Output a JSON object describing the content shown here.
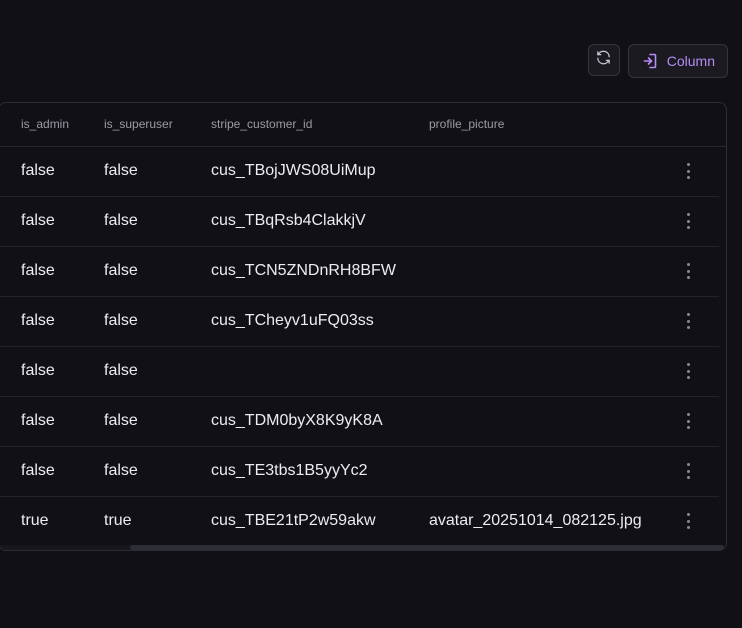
{
  "toolbar": {
    "refresh_icon": "refresh-icon",
    "column_icon": "column-add-icon",
    "column_label": "Column",
    "accent_color": "#b68cf5"
  },
  "table": {
    "columns": [
      "is_admin",
      "is_superuser",
      "stripe_customer_id",
      "profile_picture"
    ],
    "rows": [
      {
        "is_admin": "false",
        "is_superuser": "false",
        "stripe_customer_id": "cus_TBojJWS08UiMup",
        "profile_picture": ""
      },
      {
        "is_admin": "false",
        "is_superuser": "false",
        "stripe_customer_id": "cus_TBqRsb4ClakkjV",
        "profile_picture": ""
      },
      {
        "is_admin": "false",
        "is_superuser": "false",
        "stripe_customer_id": "cus_TCN5ZNDnRH8BFW",
        "profile_picture": ""
      },
      {
        "is_admin": "false",
        "is_superuser": "false",
        "stripe_customer_id": "cus_TCheyv1uFQ03ss",
        "profile_picture": ""
      },
      {
        "is_admin": "false",
        "is_superuser": "false",
        "stripe_customer_id": "",
        "profile_picture": ""
      },
      {
        "is_admin": "false",
        "is_superuser": "false",
        "stripe_customer_id": "cus_TDM0byX8K9yK8A",
        "profile_picture": ""
      },
      {
        "is_admin": "false",
        "is_superuser": "false",
        "stripe_customer_id": "cus_TE3tbs1B5yyYc2",
        "profile_picture": ""
      },
      {
        "is_admin": "true",
        "is_superuser": "true",
        "stripe_customer_id": "cus_TBE21tP2w59akw",
        "profile_picture": "avatar_20251014_082125.jpg"
      }
    ],
    "row_action_icon": "more-vertical-icon"
  }
}
